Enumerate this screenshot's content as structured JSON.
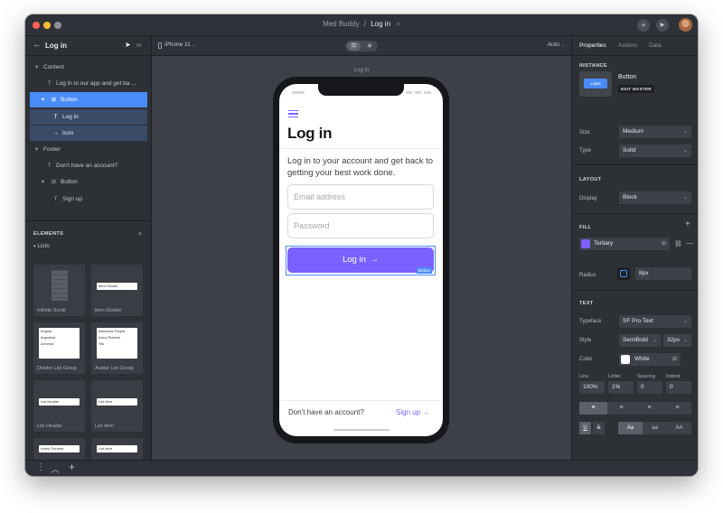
{
  "window": {
    "breadcrumb_app": "Med Buddy",
    "breadcrumb_sep": "/",
    "breadcrumb_page": "Log in",
    "close_glyph": "×",
    "traffic_lights": [
      "#ff5f57",
      "#febc2e",
      "#8e9199"
    ]
  },
  "left_panel": {
    "header_title": "Log in",
    "tree": [
      {
        "label": "Content",
        "icon": "chevron-down-icon",
        "indent": 0,
        "state": "normal"
      },
      {
        "label": "Log in to our app and get ba ...",
        "icon": "text-icon",
        "indent": 2,
        "state": "normal"
      },
      {
        "label": "Button",
        "icon": "frame-icon",
        "indent": 1,
        "state": "selected"
      },
      {
        "label": "Log in",
        "icon": "text-icon",
        "indent": 3,
        "state": "child"
      },
      {
        "label": "Icon",
        "icon": "arrow-icon",
        "indent": 3,
        "state": "child"
      },
      {
        "label": "Footer",
        "icon": "chevron-down-icon",
        "indent": 0,
        "state": "normal"
      },
      {
        "label": "Don't have an account?",
        "icon": "text-icon",
        "indent": 2,
        "state": "normal"
      },
      {
        "label": "Button",
        "icon": "frame-icon",
        "indent": 1,
        "state": "normal"
      },
      {
        "label": "Sign up",
        "icon": "text-icon",
        "indent": 3,
        "state": "normal"
      }
    ],
    "elements_title": "ELEMENTS",
    "lists_label": "Lists",
    "tiles": [
      {
        "label": "Infinite Scroll"
      },
      {
        "label": "Item Divider",
        "mini_text": "Item Divider"
      },
      {
        "label": "Divider List Group",
        "mini_lines": [
          "Angola",
          "Argentina",
          "Armenia"
        ]
      },
      {
        "label": "Avatar List Group",
        "mini_lines": [
          "Awesome People",
          "Avery Roberts",
          "Tito"
        ]
      },
      {
        "label": "List Header",
        "mini_text": "List Header"
      },
      {
        "label": "List Item",
        "mini_text": "List Item"
      },
      {
        "label": "",
        "mini_text": "Avery Roberts"
      },
      {
        "label": "",
        "mini_text": "List Item"
      }
    ]
  },
  "canvas": {
    "device_label": "iPhone 11",
    "zoom_label": "Auto",
    "frame_label": "Log in",
    "screen": {
      "title": "Log in",
      "subtitle": "Log in to your account and get back to getting your best work done.",
      "email_placeholder": "Email address",
      "password_placeholder": "Password",
      "login_button_label": "Log in",
      "selection_tag": "Button",
      "footer_text": "Don't have an account?",
      "signup_label": "Sign up",
      "accent": "#7b61ff",
      "selection_color": "#4a8cf7"
    }
  },
  "right_panel": {
    "tabs": [
      "Properties",
      "Actions",
      "Data"
    ],
    "active_tab": "Properties",
    "instance": {
      "section": "INSTANCE",
      "thumb_label": "Label",
      "name": "Button",
      "edit_master": "EDIT MASTER",
      "size_label": "Size",
      "size_value": "Medium",
      "type_label": "Type",
      "type_value": "Solid"
    },
    "layout": {
      "section": "LAYOUT",
      "display_label": "Display",
      "display_value": "Block"
    },
    "fill": {
      "section": "FILL",
      "swatch": "#7b61ff",
      "value": "Tertiary"
    },
    "radius": {
      "label": "Radius",
      "value": "8px"
    },
    "text": {
      "section": "TEXT",
      "typeface_label": "Typeface",
      "typeface_value": "SF Pro Text",
      "style_label": "Style",
      "style_value": "SemiBold",
      "size_value": "32px",
      "color_label": "Color",
      "color_value": "White",
      "line_label": "Line",
      "line_value": "100%",
      "letter_label": "Letter",
      "letter_value": "1%",
      "spacing_label": "Spacing",
      "spacing_value": "0",
      "indent_label": "Indent",
      "indent_value": "0",
      "case_options": [
        "Aa",
        "aa",
        "AA"
      ],
      "underline_glyph": "U",
      "strike_glyph": "S"
    }
  }
}
